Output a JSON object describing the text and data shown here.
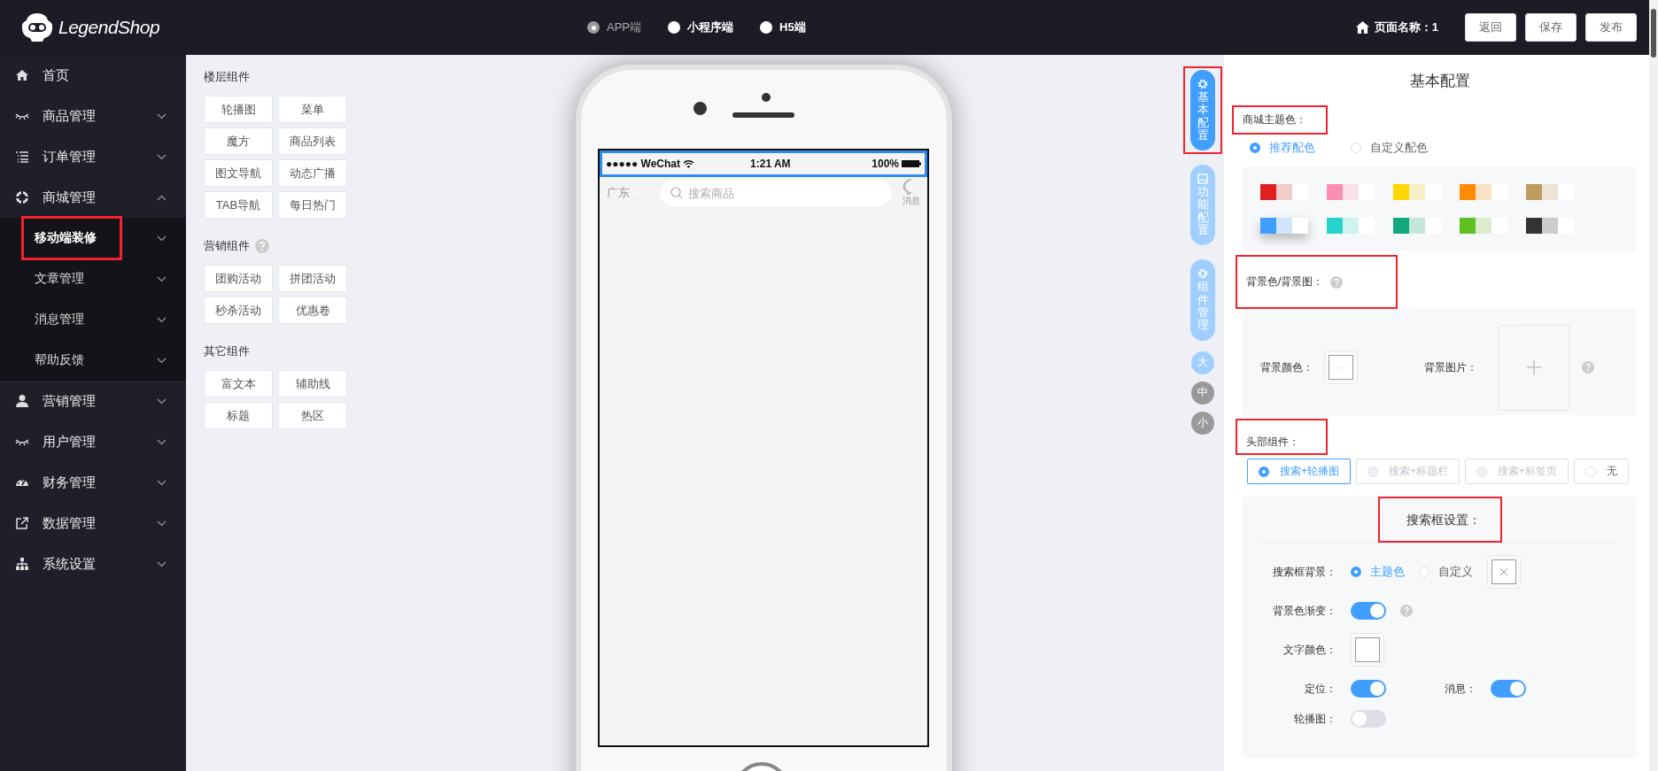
{
  "logo": {
    "text": "LegendShop"
  },
  "platforms": [
    {
      "label": "APP端",
      "selected": true
    },
    {
      "label": "小程序端",
      "selected": false
    },
    {
      "label": "H5端",
      "selected": false
    }
  ],
  "page_name": "页面名称：1",
  "header_buttons": [
    "返回",
    "保存",
    "发布"
  ],
  "sidebar": [
    {
      "label": "首页",
      "kind": "link"
    },
    {
      "label": "商品管理",
      "kind": "menu",
      "expanded": false
    },
    {
      "label": "订单管理",
      "kind": "menu",
      "expanded": false
    },
    {
      "label": "商城管理",
      "kind": "menu",
      "expanded": true,
      "children": [
        {
          "label": "移动端装修",
          "selected": true,
          "marked": true
        },
        {
          "label": "文章管理",
          "selected": false,
          "marked": false
        },
        {
          "label": "消息管理",
          "selected": false,
          "marked": false
        },
        {
          "label": "帮助反馈",
          "selected": false,
          "marked": false
        }
      ]
    },
    {
      "label": "营销管理",
      "kind": "menu",
      "expanded": false
    },
    {
      "label": "用户管理",
      "kind": "menu",
      "expanded": false
    },
    {
      "label": "财务管理",
      "kind": "menu",
      "expanded": false
    },
    {
      "label": "数据管理",
      "kind": "menu",
      "expanded": false
    },
    {
      "label": "系统设置",
      "kind": "menu",
      "expanded": false
    }
  ],
  "component_groups": [
    {
      "title": "楼层组件",
      "help": false,
      "items": [
        "轮播图",
        "菜单",
        "魔方",
        "商品列表",
        "图文导航",
        "动态广播",
        "TAB导航",
        "每日热门"
      ]
    },
    {
      "title": "营销组件",
      "help": true,
      "items": [
        "团购活动",
        "拼团活动",
        "秒杀活动",
        "优惠卷"
      ]
    },
    {
      "title": "其它组件",
      "help": false,
      "items": [
        "富文本",
        "辅助线",
        "标题",
        "热区"
      ]
    }
  ],
  "phone": {
    "carrier": "●●●●● WeChat",
    "time": "1:21 AM",
    "battery": "100%",
    "location": "广东",
    "search_placeholder": "搜索商品",
    "message_label": "消息"
  },
  "side_tabs": [
    {
      "label": "基本配置",
      "selected": true,
      "marked": true
    },
    {
      "label": "功能配置",
      "selected": false,
      "marked": false
    },
    {
      "label": "组件管理",
      "selected": false,
      "marked": false
    }
  ],
  "size_options": [
    {
      "label": "大",
      "selected": true
    },
    {
      "label": "中",
      "selected": false
    },
    {
      "label": "小",
      "selected": false
    }
  ],
  "config": {
    "title": "基本配置",
    "theme": {
      "label": "商城主题色：",
      "marked": true,
      "options": [
        {
          "label": "推荐配色",
          "selected": true
        },
        {
          "label": "自定义配色",
          "selected": false
        }
      ],
      "palettes": [
        {
          "swatches": [
            {
              "color": "#e02020"
            },
            {
              "color": "#f2cbcb"
            },
            {
              "color": "#ffffff"
            }
          ],
          "selected": false
        },
        {
          "swatches": [
            {
              "color": "#fb8db0"
            },
            {
              "color": "#fbe0e8"
            },
            {
              "color": "#ffffff"
            }
          ],
          "selected": false
        },
        {
          "swatches": [
            {
              "color": "#ffd600"
            },
            {
              "color": "#f8f0c6"
            },
            {
              "color": "#ffffff"
            }
          ],
          "selected": false
        },
        {
          "swatches": [
            {
              "color": "#ff8c00"
            },
            {
              "color": "#fae0c4"
            },
            {
              "color": "#ffffff"
            }
          ],
          "selected": false
        },
        {
          "swatches": [
            {
              "color": "#bd9c5e"
            },
            {
              "color": "#ede4d6"
            },
            {
              "color": "#ffffff"
            }
          ],
          "selected": false
        },
        {
          "swatches": [
            {
              "color": "#409eff"
            },
            {
              "color": "#d0e6fd"
            },
            {
              "color": "#ffffff"
            }
          ],
          "selected": true
        },
        {
          "swatches": [
            {
              "color": "#26d4cc"
            },
            {
              "color": "#d0f2f0"
            },
            {
              "color": "#ffffff"
            }
          ],
          "selected": false
        },
        {
          "swatches": [
            {
              "color": "#13a77f"
            },
            {
              "color": "#c6e6dd"
            },
            {
              "color": "#ffffff"
            }
          ],
          "selected": false
        },
        {
          "swatches": [
            {
              "color": "#5ec121"
            },
            {
              "color": "#daeccd"
            },
            {
              "color": "#ffffff"
            }
          ],
          "selected": false
        },
        {
          "swatches": [
            {
              "color": "#333333"
            },
            {
              "color": "#cccccc"
            },
            {
              "color": "#ffffff"
            }
          ],
          "selected": false
        }
      ]
    },
    "background": {
      "label": "背景色/背景图：",
      "marked": true,
      "color_label": "背景颜色：",
      "image_label": "背景图片："
    },
    "header": {
      "label": "头部组件：",
      "marked": true,
      "options": [
        {
          "label": "搜索+轮播图",
          "selected": true,
          "disabled": false
        },
        {
          "label": "搜索+标题栏",
          "selected": false,
          "disabled": true
        },
        {
          "label": "搜索+标签页",
          "selected": false,
          "disabled": true
        },
        {
          "label": "无",
          "selected": false,
          "disabled": false
        }
      ]
    },
    "search": {
      "title": "搜索框设置：",
      "marked": true,
      "bg_label": "搜索框背景：",
      "bg_options": [
        {
          "label": "主题色",
          "selected": true
        },
        {
          "label": "自定义",
          "selected": false
        }
      ],
      "gradient": {
        "label": "背景色渐变：",
        "on": true
      },
      "text_color_label": "文字颜色：",
      "toggles": [
        {
          "label": "定位：",
          "on": true
        },
        {
          "label": "消息：",
          "on": true
        },
        {
          "label": "轮播图：",
          "on": false
        }
      ]
    }
  }
}
